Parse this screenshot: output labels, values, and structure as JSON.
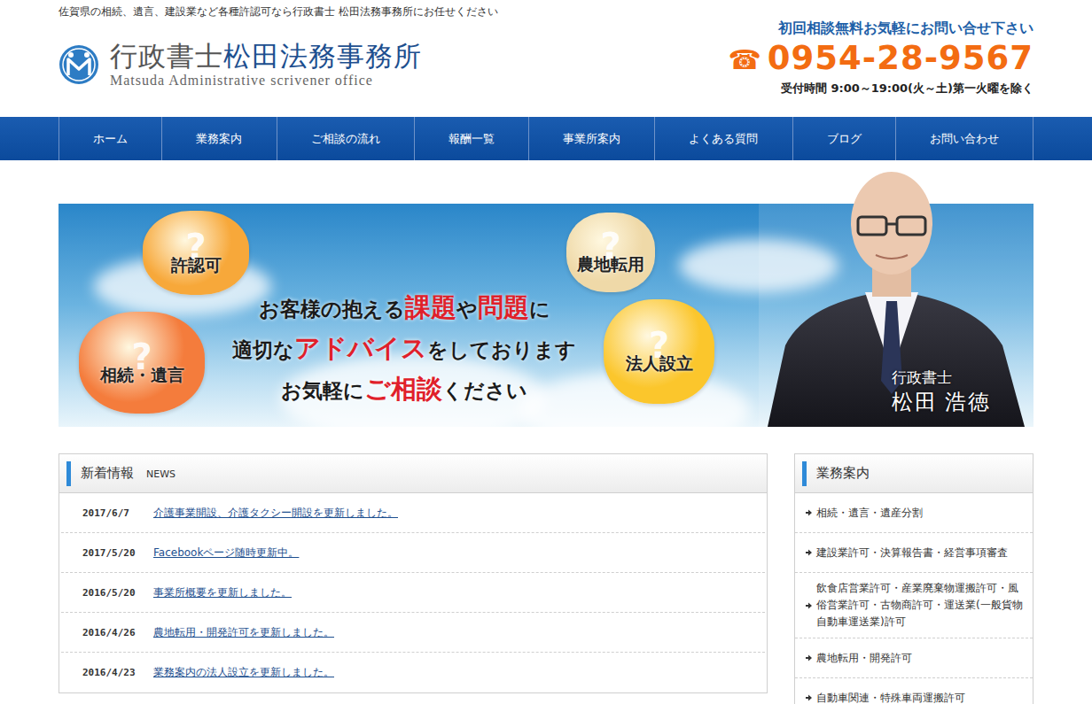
{
  "tagline": "佐賀県の相続、遺言、建設業など各種許認可なら行政書士 松田法務事務所にお任せください",
  "logo": {
    "title_prefix": "行政書士",
    "title_main": "松田法務事務所",
    "subtitle": "Matsuda Administrative scrivener office"
  },
  "contact": {
    "lead": "初回相談無料お気軽にお問い合せ下さい",
    "phone_icon": "☎",
    "phone": "0954-28-9567",
    "hours": "受付時間 9:00～19:00(火～土)第一火曜を除く"
  },
  "nav": [
    {
      "label": "ホーム"
    },
    {
      "label": "業務案内"
    },
    {
      "label": "ご相談の流れ"
    },
    {
      "label": "報酬一覧"
    },
    {
      "label": "事業所案内"
    },
    {
      "label": "よくある質問"
    },
    {
      "label": "ブログ"
    },
    {
      "label": "お問い合わせ"
    }
  ],
  "banner": {
    "mark": "?",
    "bubbles": [
      {
        "label": "許認可",
        "color": "#f7a83a"
      },
      {
        "label": "農地転用",
        "color": "#efd9a8"
      },
      {
        "label": "相続・遺言",
        "color": "#f47c3c"
      },
      {
        "label": "法人設立",
        "color": "#fbc62c"
      }
    ],
    "lines": [
      [
        {
          "text": "お客様の抱える",
          "highlight": false
        },
        {
          "text": "課題",
          "highlight": true
        },
        {
          "text": "や",
          "highlight": false
        },
        {
          "text": "問題",
          "highlight": true
        },
        {
          "text": "に",
          "highlight": false
        }
      ],
      [
        {
          "text": "適切な",
          "highlight": false
        },
        {
          "text": "アドバイス",
          "highlight": true
        },
        {
          "text": "をしております",
          "highlight": false
        }
      ],
      [
        {
          "text": "お気軽に",
          "highlight": false
        },
        {
          "text": "ご相談",
          "highlight": true
        },
        {
          "text": "ください",
          "highlight": false
        }
      ]
    ],
    "person": {
      "title": "行政書士",
      "name": "松田 浩徳"
    }
  },
  "news": {
    "title": "新着情報",
    "subtitle": "NEWS",
    "items": [
      {
        "date": "2017/6/7",
        "text": "介護事業開設、介護タクシー開設を更新しました。"
      },
      {
        "date": "2017/5/20",
        "text": "Facebookページ随時更新中。"
      },
      {
        "date": "2016/5/20",
        "text": "事業所概要を更新しました。"
      },
      {
        "date": "2016/4/26",
        "text": "農地転用・開発許可を更新しました。"
      },
      {
        "date": "2016/4/23",
        "text": "業務案内の法人設立を更新しました。"
      }
    ]
  },
  "services": {
    "title": "業務案内",
    "items": [
      "相続・遺言・遺産分割",
      "建設業許可・決算報告書・経営事項審査",
      "飲食店営業許可・産業廃棄物運搬許可・風俗営業許可・古物商許可・運送業(一般貨物自動車運送業)許可",
      "農地転用・開発許可",
      "自動車関連・特殊車両運搬許可"
    ]
  }
}
